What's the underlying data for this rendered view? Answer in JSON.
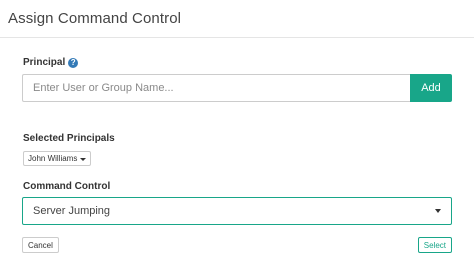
{
  "dialog": {
    "title": "Assign Command Control"
  },
  "principal": {
    "label": "Principal",
    "help_icon_glyph": "?",
    "help_icon": "question-circle-icon",
    "input_placeholder": "Enter User or Group Name...",
    "input_value": "",
    "add_label": "Add"
  },
  "selected_principals": {
    "label": "Selected Principals",
    "items": [
      {
        "name": "John Williams"
      }
    ]
  },
  "command_control": {
    "label": "Command Control",
    "selected_value": "Server Jumping"
  },
  "footer": {
    "cancel_label": "Cancel",
    "select_label": "Select"
  },
  "colors": {
    "accent": "#18a689",
    "help_icon": "#337ab7",
    "border": "#cccccc"
  }
}
